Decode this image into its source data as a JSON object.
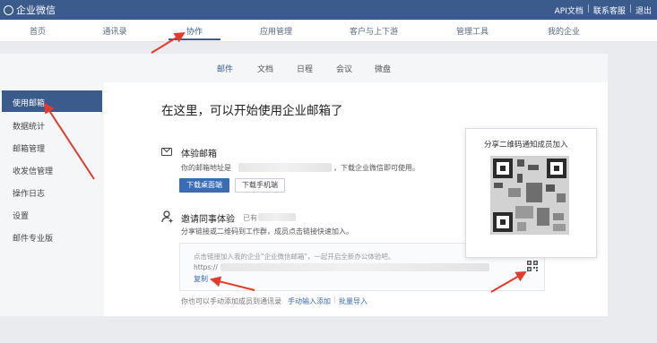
{
  "app": {
    "name": "企业微信"
  },
  "top_links": [
    "API文档",
    "联系客服",
    "退出"
  ],
  "main_nav": [
    {
      "label": "首页"
    },
    {
      "label": "通讯录"
    },
    {
      "label": "协作"
    },
    {
      "label": "应用管理"
    },
    {
      "label": "客户与上下游"
    },
    {
      "label": "管理工具"
    },
    {
      "label": "我的企业"
    }
  ],
  "main_nav_active": "协作",
  "sub_nav": [
    {
      "label": "邮件"
    },
    {
      "label": "文档"
    },
    {
      "label": "日程"
    },
    {
      "label": "会议"
    },
    {
      "label": "微盘"
    }
  ],
  "sub_nav_active": "邮件",
  "sidebar": [
    {
      "label": "使用邮箱"
    },
    {
      "label": "数据统计"
    },
    {
      "label": "邮箱管理"
    },
    {
      "label": "收发信管理"
    },
    {
      "label": "操作日志"
    },
    {
      "label": "设置"
    },
    {
      "label": "邮件专业版"
    }
  ],
  "sidebar_active": "使用邮箱",
  "headline": "在这里，可以开始使用企业邮箱了",
  "trial": {
    "title": "体验邮箱",
    "address_prefix": "你的邮箱地址是",
    "address_suffix": "，下载企业微信即可使用。",
    "btn_desktop": "下载桌面端",
    "btn_mobile": "下载手机端"
  },
  "invite": {
    "title": "邀请同事体验",
    "status_prefix": "已有",
    "desc": "分享链接或二维码到工作群，成员点击链接快速加入。",
    "link_text": "点击链接加入我的企业\"企业微信邮箱\"，一起开启全新办公体验吧。",
    "link_url_prefix": "https://",
    "copy_label": "复制",
    "manual_text": "你也可以手动添加成员到通讯录",
    "manual_add": "手动输入添加",
    "batch_import": "批量导入"
  },
  "qr_popup": {
    "title": "分享二维码通知成员加入"
  },
  "colors": {
    "brand": "#3b5b8c",
    "button": "#3a6cb3",
    "annotation": "#e53a2a"
  },
  "icons": [
    "logo-icon",
    "mail-icon",
    "person-add-icon",
    "qr-code-icon"
  ]
}
